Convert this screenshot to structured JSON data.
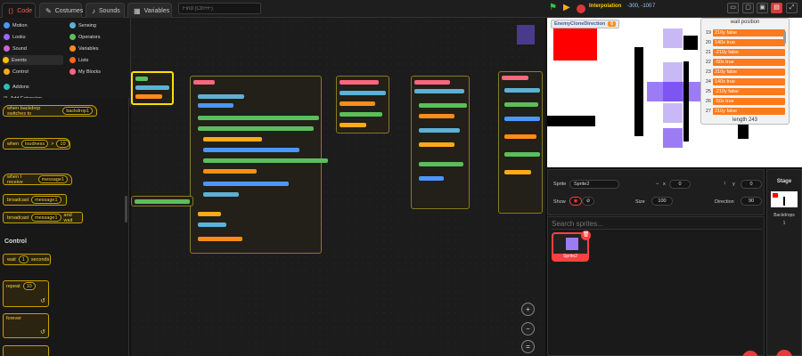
{
  "tabs": [
    {
      "label": "Code",
      "icon": "code-icon"
    },
    {
      "label": "Costumes",
      "icon": "brush-icon"
    },
    {
      "label": "Sounds",
      "icon": "speaker-icon"
    },
    {
      "label": "Variables",
      "icon": "variables-icon"
    }
  ],
  "search": {
    "placeholder": "Find (Ctrl+F)"
  },
  "player": {
    "interpolation": "Interpolation",
    "coords": "-300, -100",
    "fps": "7"
  },
  "categories": [
    {
      "label": "Motion",
      "color": "#4c97ff"
    },
    {
      "label": "Looks",
      "color": "#9966ff"
    },
    {
      "label": "Sound",
      "color": "#cf63cf"
    },
    {
      "label": "Events",
      "color": "#ffbf00"
    },
    {
      "label": "Control",
      "color": "#ffab19"
    },
    {
      "label": "Sensing",
      "color": "#5cb1d6"
    },
    {
      "label": "Operators",
      "color": "#59c059"
    },
    {
      "label": "Variables",
      "color": "#ff8c1a"
    },
    {
      "label": "Lists",
      "color": "#ff661a"
    },
    {
      "label": "My Blocks",
      "color": "#ff6680"
    }
  ],
  "addons": "Addons",
  "add_extension": "Add Extension",
  "palette": {
    "backdrop_switch": "when backdrop switches to",
    "backdrop_value": "backdrop1",
    "when": "when",
    "loudness": "loudness",
    "gt": ">",
    "loud_value": "10",
    "when_receive": "when I receive",
    "message": "message1",
    "broadcast": "broadcast",
    "broadcast_wait_suffix": "and wait",
    "control_section": "Control",
    "wait": "wait",
    "wait_value": "1",
    "seconds": "seconds",
    "repeat": "repeat",
    "repeat_value": "10",
    "forever": "forever"
  },
  "stage": {
    "monitor_label": "EnemyCloneDirection",
    "monitor_value": "6",
    "list_title": "wall position",
    "list_items": [
      {
        "idx": "19",
        "value": "210y false"
      },
      {
        "idx": "20",
        "value": "140x true"
      },
      {
        "idx": "21",
        "value": "-210y false"
      },
      {
        "idx": "22",
        "value": "-50x true"
      },
      {
        "idx": "23",
        "value": "210y false"
      },
      {
        "idx": "24",
        "value": "140x true"
      },
      {
        "idx": "25",
        "value": "-210y false"
      },
      {
        "idx": "26",
        "value": "-50x true"
      },
      {
        "idx": "27",
        "value": "210y false"
      }
    ],
    "list_length": "length 243"
  },
  "sprite_info": {
    "sprite_label": "Sprite",
    "sprite_name": "Sprite2",
    "x_label": "x",
    "x_value": "0",
    "y_label": "y",
    "y_value": "0",
    "show_label": "Show",
    "size_label": "Size",
    "size_value": "100",
    "direction_label": "Direction",
    "direction_value": "90"
  },
  "sprites_pane": {
    "search_placeholder": "Search sprites...",
    "sprites": [
      {
        "name": "Sprite2"
      }
    ]
  },
  "stage_pane": {
    "title": "Stage",
    "backdrops_label": "Backdrops",
    "backdrops_count": "1"
  },
  "zoom": {
    "in": "+",
    "out": "−",
    "reset": "="
  }
}
